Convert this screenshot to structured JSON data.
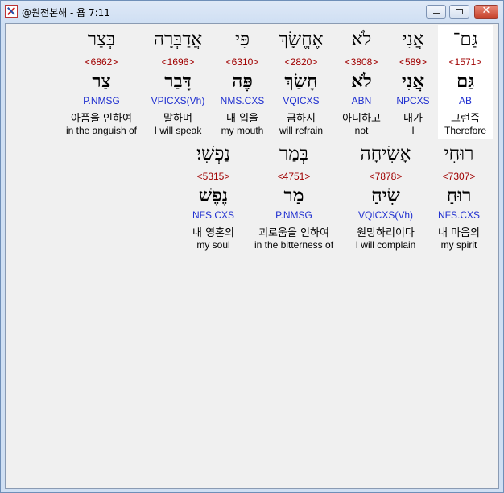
{
  "window": {
    "title": "@원전본해 - 욥 7:11",
    "close_glyph": "✕"
  },
  "rows": [
    {
      "words": [
        {
          "heb": "גַּם־",
          "strong": "<1571>",
          "heb2": "גַּם",
          "morph": "AB",
          "korean": "그런즉",
          "english": "Therefore"
        },
        {
          "heb": "אֲנִי",
          "strong": "<589>",
          "heb2": "אֲנִי",
          "morph": "NPCXS",
          "korean": "내가",
          "english": "I"
        },
        {
          "heb": "לֹא",
          "strong": "<3808>",
          "heb2": "לֹא",
          "morph": "ABN",
          "korean": "아니하고",
          "english": "not"
        },
        {
          "heb": "אֶחֱשָׂךְ",
          "strong": "<2820>",
          "heb2": "חָשַׂךְ",
          "morph": "VQICXS",
          "korean": "금하지",
          "english": "will refrain"
        },
        {
          "heb": "פִּי",
          "strong": "<6310>",
          "heb2": "פֶּה",
          "morph": "NMS.CXS",
          "korean": "내 입을",
          "english": "my mouth"
        },
        {
          "heb": "אֲדַבְּרָה",
          "strong": "<1696>",
          "heb2": "דָּבַר",
          "morph": "VPICXS(Vh)",
          "korean": "말하며",
          "english": "I will speak"
        },
        {
          "heb": "בְּצַר",
          "strong": "<6862>",
          "heb2": "צַר",
          "morph": "P.NMSG",
          "korean": "아픔을 인하여",
          "english": "in the anguish of"
        }
      ]
    },
    {
      "words": [
        {
          "heb": "רוּחִי",
          "strong": "<7307>",
          "heb2": "רוּחַ",
          "morph": "NFS.CXS",
          "korean": "내 마음의",
          "english": "my spirit"
        },
        {
          "heb": "אָשִׂיחָה",
          "strong": "<7878>",
          "heb2": "שִׂיחַ",
          "morph": "VQICXS(Vh)",
          "korean": "원망하리이다",
          "english": "I will complain"
        },
        {
          "heb": "בְּמַר",
          "strong": "<4751>",
          "heb2": "מַר",
          "morph": "P.NMSG",
          "korean": "괴로움을 인하여",
          "english": "in the bitterness of"
        },
        {
          "heb": "נַפְשִׁי׃",
          "strong": "<5315>",
          "heb2": "נֶפֶשׁ",
          "morph": "NFS.CXS",
          "korean": "내 영혼의",
          "english": "my soul"
        }
      ]
    }
  ]
}
